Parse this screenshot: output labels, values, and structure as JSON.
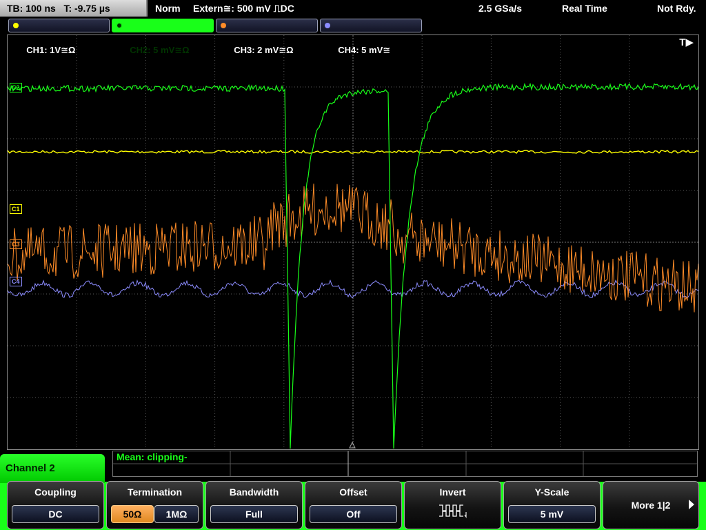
{
  "header": {
    "timebase": "TB: 100 ns   T: -9.75 µs",
    "acq_mode": "Norm",
    "trigger": "Extern≅: 500 mV ⎍DC",
    "sample_rate": "2.5 GSa/s",
    "realtime": "Real Time",
    "status": "Not Rdy."
  },
  "channels": [
    {
      "label": "CH1: 1V≅Ω",
      "color": "#ffff00",
      "active": false
    },
    {
      "label": "CH2: 5 mV≅Ω",
      "color": "#19ff19",
      "active": true
    },
    {
      "label": "CH3: 2 mV≅Ω",
      "color": "#ff8c28",
      "active": false
    },
    {
      "label": "CH4: 5 mV≅",
      "color": "#8c8cff",
      "active": false
    }
  ],
  "display": {
    "trigger_marker": "T▶",
    "ch_labels": {
      "c2": "C2",
      "c1": "C1",
      "c3": "C3",
      "c4": "C4"
    }
  },
  "measurement": {
    "text": "Mean: clipping-"
  },
  "menu": {
    "title": "Channel 2",
    "softkeys": {
      "coupling": {
        "title": "Coupling",
        "value": "DC"
      },
      "termination": {
        "title": "Termination",
        "opt1": "50Ω",
        "opt2": "1MΩ",
        "selected": "50Ω"
      },
      "bandwidth": {
        "title": "Bandwidth",
        "value": "Full"
      },
      "offset": {
        "title": "Offset",
        "value": "Off"
      },
      "invert": {
        "title": "Invert"
      },
      "yscale": {
        "title": "Y-Scale",
        "value": "5 mV"
      },
      "more": {
        "title": "More 1|2"
      }
    }
  },
  "colors": {
    "ch1": "#ffff00",
    "ch2": "#19ff19",
    "ch3": "#ff8c28",
    "ch4": "#8c8cff",
    "grid": "#5a5a5a"
  }
}
